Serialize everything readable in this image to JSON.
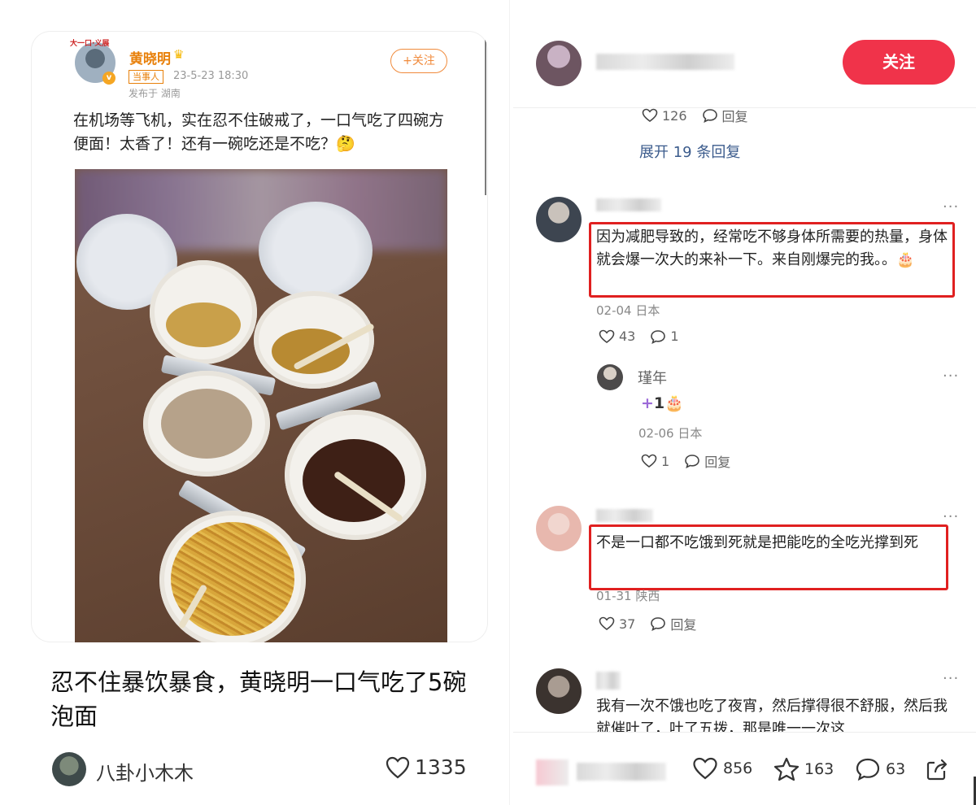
{
  "left": {
    "weibo": {
      "banner": "大一口·义展",
      "author": "黄晓明",
      "verified_badge": "v",
      "role_tag": "当事人",
      "time": "23-5-23 18:30",
      "from": "发布于 湖南",
      "follow_label": "+关注",
      "text": "在机场等飞机，实在忍不住破戒了，一口气吃了四碗方便面！太香了！还有一碗吃还是不吃？🤔"
    },
    "headline": "忍不住暴饮暴食，黄晓明一口气吃了5碗泡面",
    "author_name": "八卦小木木",
    "likes": "1335"
  },
  "right": {
    "follow_label": "关注",
    "top_reply_meta": {
      "likes": "126",
      "reply_label": "回复"
    },
    "expand_label": "展开 19 条回复",
    "comments": [
      {
        "text": "因为减肥导致的，经常吃不够身体所需要的热量，身体就会爆一次大的来补一下。来自刚爆完的我。。🎂",
        "date": "02-04 日本",
        "likes": "43",
        "replies": "1",
        "sub_reply": {
          "name": "瑾年",
          "plus": "+",
          "plus_text": "1🎂",
          "date": "02-06 日本",
          "likes": "1",
          "reply_label": "回复"
        }
      },
      {
        "text": "不是一口都不吃饿到死就是把能吃的全吃光撑到死",
        "date": "01-31 陕西",
        "likes": "37",
        "reply_label": "回复"
      },
      {
        "text": "我有一次不饿也吃了夜宵，然后撑得很不舒服，然后我就催吐了，吐了五拨，那是唯一一次这"
      }
    ],
    "bottom": {
      "likes": "856",
      "stars": "163",
      "comments": "63"
    },
    "dots": "···"
  },
  "colors": {
    "accent_red": "#f0334a",
    "highlight_box": "#e02020",
    "weibo_orange": "#e8800a",
    "link_blue": "#3b5b8c"
  }
}
